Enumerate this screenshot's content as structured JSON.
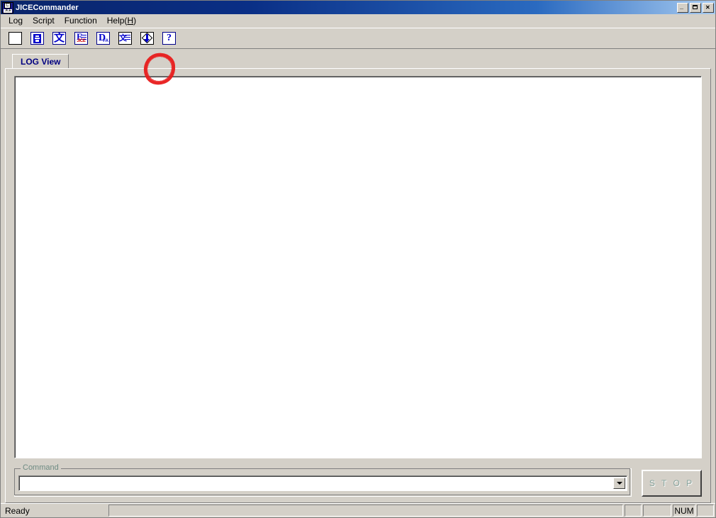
{
  "window": {
    "title": "JICECommander",
    "icon": "app-icon-jice",
    "caption_buttons": [
      {
        "name": "minimize-button",
        "label": "_"
      },
      {
        "name": "maximize-button",
        "label": "□"
      },
      {
        "name": "close-button",
        "label": "✕"
      }
    ],
    "title_bar_color": "#0a246a",
    "face_color": "#d4d0c8"
  },
  "menu": {
    "items": [
      {
        "label": "Log",
        "mnemonic": ""
      },
      {
        "label": "Script",
        "mnemonic": ""
      },
      {
        "label": "Function",
        "mnemonic": ""
      },
      {
        "label": "Help(",
        "mnemonic": "H",
        "suffix": ")"
      }
    ]
  },
  "toolbar": {
    "buttons": [
      {
        "name": "new-log-button",
        "icon": "blank-document-icon",
        "tooltip": "New"
      },
      {
        "name": "save-log-button",
        "icon": "floppy-save-icon",
        "tooltip": "Save"
      },
      {
        "name": "script-run-button",
        "icon": "kanji-script-icon",
        "tooltip": "Script"
      },
      {
        "name": "jice-log-button",
        "icon": "jice-log-icon",
        "tooltip": "JICE Log"
      },
      {
        "name": "dfa-button",
        "icon": "d-fa-icon",
        "tooltip": "D fa"
      },
      {
        "name": "list-script-button",
        "icon": "kanji-list-icon",
        "tooltip": "List"
      },
      {
        "name": "download-button",
        "icon": "diamond-down-arrow-icon",
        "tooltip": "Download",
        "annotated": true
      },
      {
        "name": "help-button",
        "icon": "question-mark-icon",
        "tooltip": "Help"
      }
    ],
    "annotation": {
      "type": "hand-drawn-circle",
      "color": "#e81c1c",
      "target": "download-button"
    }
  },
  "tabs": [
    {
      "label": "LOG View",
      "selected": true,
      "color": "#000080"
    }
  ],
  "log_view": {
    "content": "",
    "background": "#ffffff"
  },
  "command": {
    "legend": "Command",
    "legend_color": "#6e8b83",
    "value": "",
    "placeholder": "",
    "dropdown_icon": "chevron-down-icon",
    "options": []
  },
  "stop_button": {
    "label": "S T O P",
    "enabled": false,
    "text_color": "#86a39c"
  },
  "status_bar": {
    "message": "Ready",
    "panes": [
      {
        "name": "status-pane-empty-1",
        "label": ""
      },
      {
        "name": "status-pane-empty-2",
        "label": ""
      },
      {
        "name": "status-pane-empty-3",
        "label": ""
      },
      {
        "name": "status-pane-num",
        "label": "NUM"
      },
      {
        "name": "status-pane-empty-4",
        "label": ""
      }
    ]
  }
}
